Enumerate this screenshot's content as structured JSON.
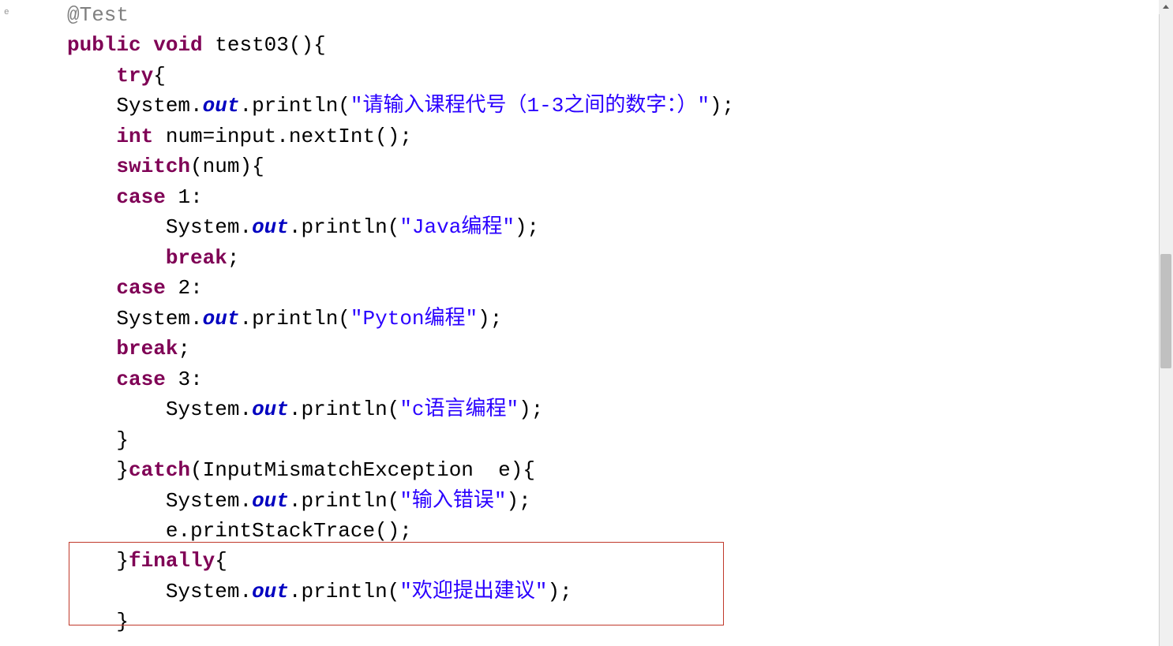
{
  "code": {
    "annotation": "@Test",
    "kw_public": "public",
    "kw_void": "void",
    "method_name": "test03",
    "kw_try": "try",
    "cls_system": "System",
    "field_out": "out",
    "fn_println": "println",
    "str_prompt": "\"请输入课程代号（1-3之间的数字：）\"",
    "kw_int": "int",
    "var_num": "num",
    "var_input": "input",
    "fn_nextInt": "nextInt",
    "kw_switch": "switch",
    "kw_case": "case",
    "lit_1": "1",
    "lit_2": "2",
    "lit_3": "3",
    "str_case1": "\"Java编程\"",
    "str_case2": "\"Pyton编程\"",
    "str_case3": "\"c语言编程\"",
    "kw_break": "break",
    "kw_catch": "catch",
    "cls_exception": "InputMismatchException",
    "var_e": "e",
    "str_err": "\"输入错误\"",
    "fn_printStackTrace": "printStackTrace",
    "kw_finally": "finally",
    "str_finally": "\"欢迎提出建议\""
  },
  "margin_marker": "e"
}
